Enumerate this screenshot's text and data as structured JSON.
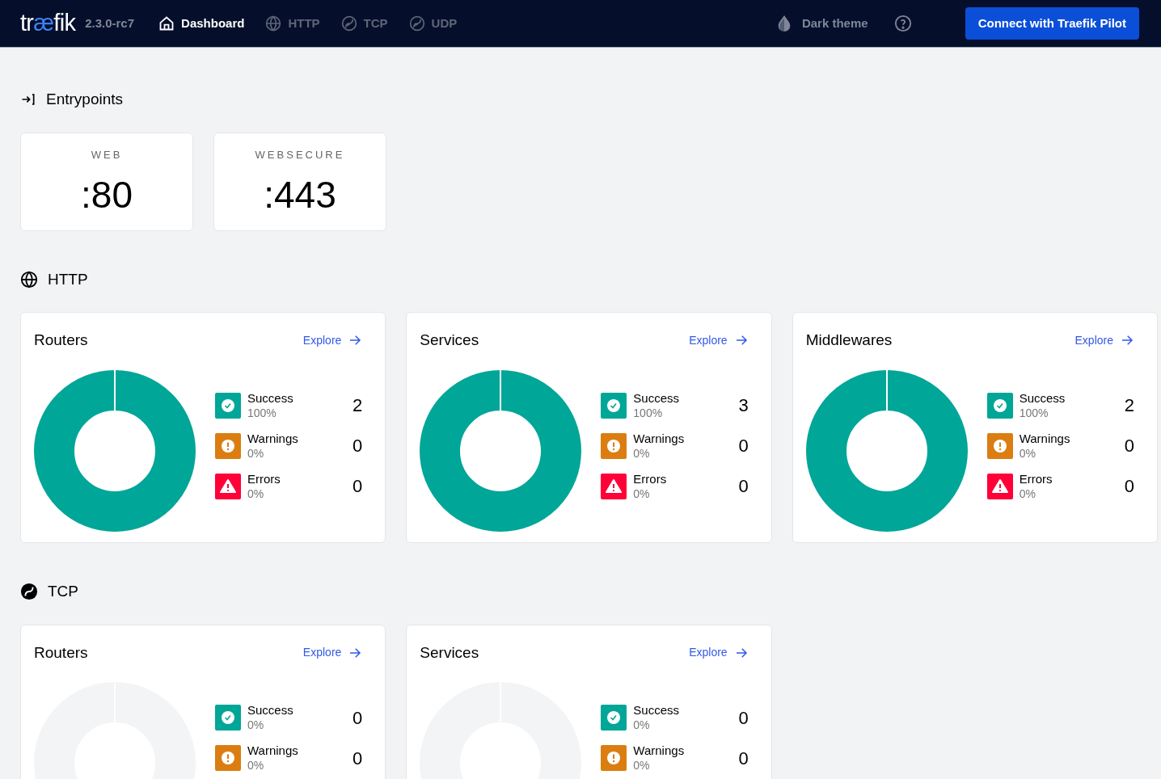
{
  "header": {
    "logo": [
      {
        "text": "tr",
        "accent": false
      },
      {
        "text": "æ",
        "accent": true
      },
      {
        "text": "fik",
        "accent": false
      }
    ],
    "version": "2.3.0-rc7",
    "nav": [
      {
        "label": "Dashboard",
        "kind": "home",
        "selected": true
      },
      {
        "label": "HTTP",
        "kind": "globe",
        "selected": false
      },
      {
        "label": "TCP",
        "kind": "tcp",
        "selected": false
      },
      {
        "label": "UDP",
        "kind": "tcp",
        "selected": false
      }
    ],
    "theme_toggle": "Dark theme",
    "pilot_button": "Connect with Traefik Pilot"
  },
  "sections": [
    {
      "title": "Entrypoints",
      "kind": "entrypoints",
      "entrypoints": [
        {
          "name": "WEB",
          "port": ":80"
        },
        {
          "name": "WEBSECURE",
          "port": ":443"
        }
      ]
    },
    {
      "title": "HTTP",
      "kind": "globe",
      "cards": [
        {
          "title": "Routers",
          "link": "Explore",
          "stats": [
            {
              "kind": "success",
              "label": "Success",
              "percent": "100%",
              "count": "2"
            },
            {
              "kind": "warning",
              "label": "Warnings",
              "percent": "0%",
              "count": "0"
            },
            {
              "kind": "error",
              "label": "Errors",
              "percent": "0%",
              "count": "0"
            }
          ]
        },
        {
          "title": "Services",
          "link": "Explore",
          "stats": [
            {
              "kind": "success",
              "label": "Success",
              "percent": "100%",
              "count": "3"
            },
            {
              "kind": "warning",
              "label": "Warnings",
              "percent": "0%",
              "count": "0"
            },
            {
              "kind": "error",
              "label": "Errors",
              "percent": "0%",
              "count": "0"
            }
          ]
        },
        {
          "title": "Middlewares",
          "link": "Explore",
          "stats": [
            {
              "kind": "success",
              "label": "Success",
              "percent": "100%",
              "count": "2"
            },
            {
              "kind": "warning",
              "label": "Warnings",
              "percent": "0%",
              "count": "0"
            },
            {
              "kind": "error",
              "label": "Errors",
              "percent": "0%",
              "count": "0"
            }
          ]
        }
      ]
    },
    {
      "title": "TCP",
      "kind": "tcp",
      "cards": [
        {
          "title": "Routers",
          "link": "Explore",
          "stats": [
            {
              "kind": "success",
              "label": "Success",
              "percent": "0%",
              "count": "0"
            },
            {
              "kind": "warning",
              "label": "Warnings",
              "percent": "0%",
              "count": "0"
            }
          ]
        },
        {
          "title": "Services",
          "link": "Explore",
          "stats": [
            {
              "kind": "success",
              "label": "Success",
              "percent": "0%",
              "count": "0"
            },
            {
              "kind": "warning",
              "label": "Warnings",
              "percent": "0%",
              "count": "0"
            }
          ]
        }
      ]
    }
  ]
}
